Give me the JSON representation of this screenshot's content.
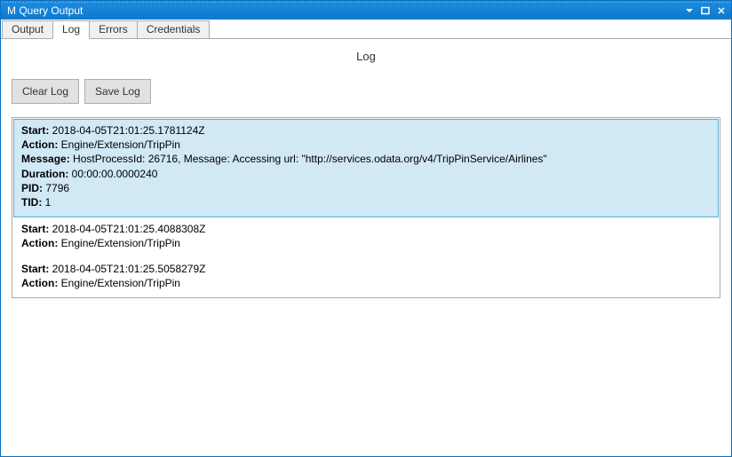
{
  "window": {
    "title": "M Query Output"
  },
  "tabs": [
    {
      "label": "Output",
      "active": false
    },
    {
      "label": "Log",
      "active": true
    },
    {
      "label": "Errors",
      "active": false
    },
    {
      "label": "Credentials",
      "active": false
    }
  ],
  "content": {
    "heading": "Log"
  },
  "toolbar": {
    "clear_label": "Clear Log",
    "save_label": "Save Log"
  },
  "labels": {
    "start": "Start: ",
    "action": "Action: ",
    "message": "Message: ",
    "duration": "Duration: ",
    "pid": "PID: ",
    "tid": "TID: "
  },
  "log_entries": [
    {
      "selected": true,
      "start": "2018-04-05T21:01:25.1781124Z",
      "action": "Engine/Extension/TripPin",
      "message": "HostProcessId: 26716, Message: Accessing url: \"http://services.odata.org/v4/TripPinService/Airlines\"",
      "duration": "00:00:00.0000240",
      "pid": "7796",
      "tid": "1"
    },
    {
      "selected": false,
      "start": "2018-04-05T21:01:25.4088308Z",
      "action": "Engine/Extension/TripPin"
    },
    {
      "selected": false,
      "start": "2018-04-05T21:01:25.5058279Z",
      "action": "Engine/Extension/TripPin"
    }
  ]
}
